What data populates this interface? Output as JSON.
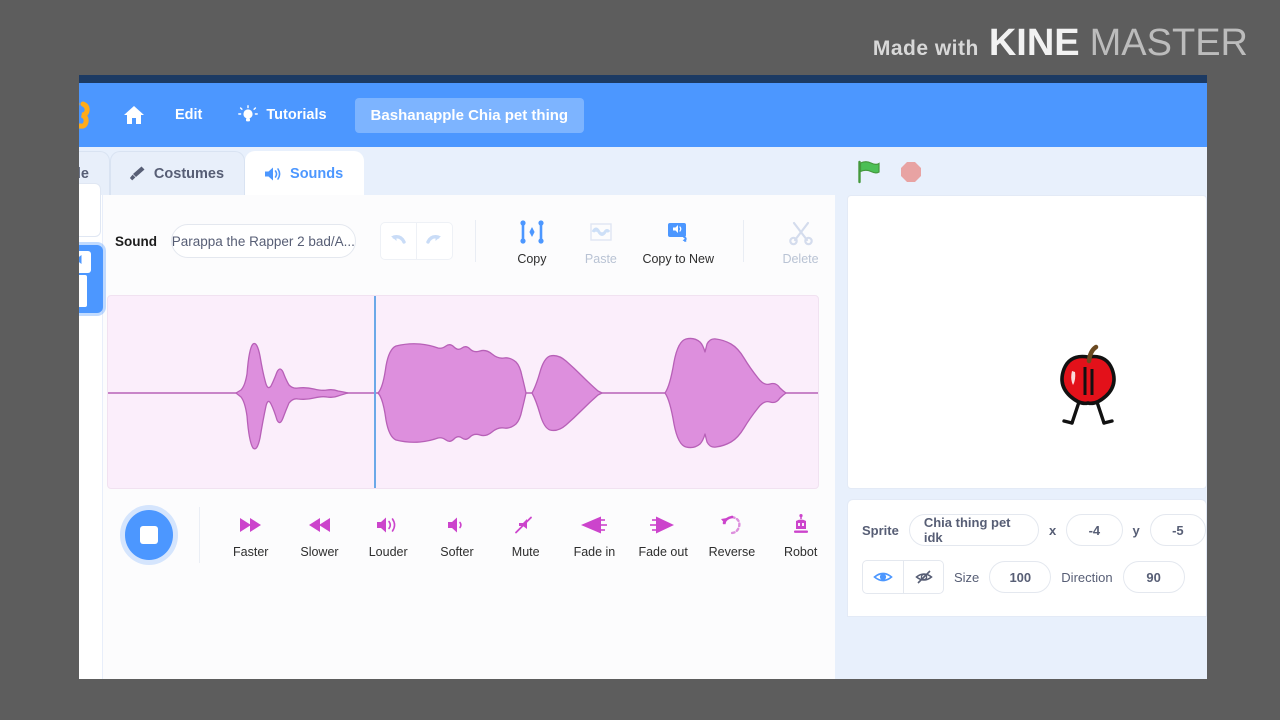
{
  "watermark": {
    "made_with": "Made with",
    "kine": "KINE",
    "master": "MASTER"
  },
  "menubar": {
    "logo": "scratch-logo",
    "home": "home-icon",
    "edit": "Edit",
    "tutorials": "Tutorials",
    "project_title": "Bashanapple Chia pet thing"
  },
  "tabs": [
    {
      "label": "de",
      "icon": "code-icon",
      "active": false
    },
    {
      "label": "Costumes",
      "icon": "paintbrush-icon",
      "active": false
    },
    {
      "label": "Sounds",
      "icon": "speaker-icon",
      "active": true
    }
  ],
  "editor": {
    "sound_label": "Sound",
    "sound_name": "Parappa the Rapper 2 bad/A...",
    "undo": "undo-icon",
    "redo": "redo-icon",
    "tools": [
      {
        "label": "Copy",
        "icon": "copy-icon",
        "disabled": false
      },
      {
        "label": "Paste",
        "icon": "paste-icon",
        "disabled": true
      },
      {
        "label": "Copy to New",
        "icon": "copy-to-new-icon",
        "disabled": false
      },
      {
        "label": "Delete",
        "icon": "scissors-icon",
        "disabled": true
      }
    ],
    "playback": {
      "state": "playing",
      "icon": "stop-square-icon"
    },
    "effects": [
      {
        "label": "Faster",
        "icon": "fast-forward-icon"
      },
      {
        "label": "Slower",
        "icon": "rewind-icon"
      },
      {
        "label": "Louder",
        "icon": "volume-up-icon"
      },
      {
        "label": "Softer",
        "icon": "volume-down-icon"
      },
      {
        "label": "Mute",
        "icon": "mute-icon"
      },
      {
        "label": "Fade in",
        "icon": "fade-in-icon"
      },
      {
        "label": "Fade out",
        "icon": "fade-out-icon"
      },
      {
        "label": "Reverse",
        "icon": "reverse-icon"
      },
      {
        "label": "Robot",
        "icon": "robot-icon"
      }
    ]
  },
  "stage": {
    "green_flag": "green-flag-icon",
    "stop": "stop-sign-icon",
    "sprite_graphic": "red-apple-character"
  },
  "sprite_panel": {
    "sprite_label": "Sprite",
    "sprite_name": "Chia thing pet idk",
    "x_label": "x",
    "x_value": "-4",
    "y_label": "y",
    "y_value": "-5",
    "show_icon": "eye-show-icon",
    "hide_icon": "eye-hide-icon",
    "size_label": "Size",
    "size_value": "100",
    "direction_label": "Direction",
    "direction_value": "90"
  },
  "colors": {
    "scratch_blue": "#4c97ff",
    "waveform_fill": "#dd8fdd",
    "waveform_bg": "#fbeefb",
    "effect_icon": "#cc44cc",
    "desktop_gray": "#5d5d5d"
  }
}
